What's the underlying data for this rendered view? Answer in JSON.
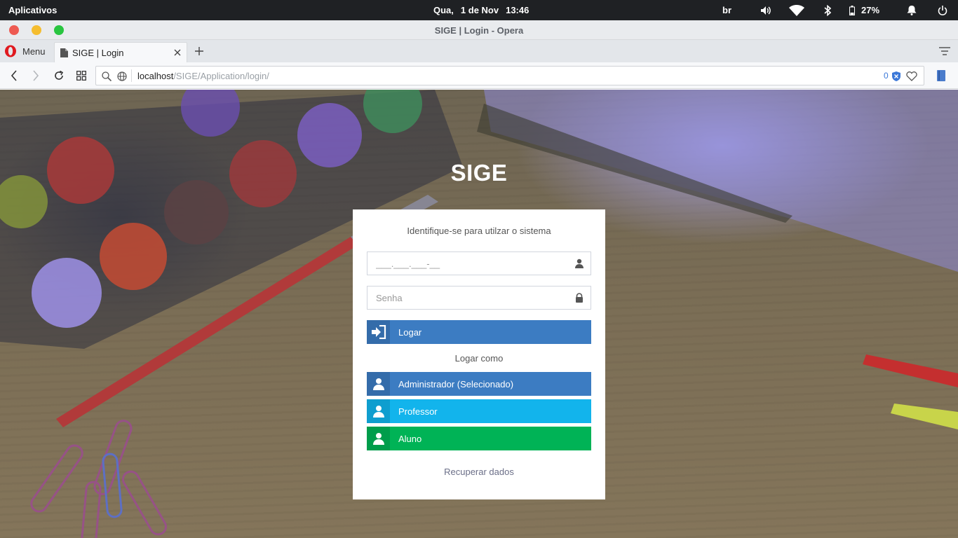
{
  "os": {
    "apps_label": "Aplicativos",
    "day": "Qua,",
    "date": "1 de Nov",
    "time": "13:46",
    "keyboard": "br",
    "battery": "27%"
  },
  "window": {
    "title": "SIGE | Login - Opera"
  },
  "browser": {
    "menu_label": "Menu",
    "tab_title": "SIGE | Login",
    "url_host": "localhost",
    "url_path": "/SIGE/Application/login/",
    "adblock_count": "0"
  },
  "page": {
    "brand": "SIGE",
    "subtitle": "Identifique-se para utilzar o sistema",
    "cpf_placeholder": "___.___.___-__",
    "password_placeholder": "Senha",
    "login_label": "Logar",
    "login_as_label": "Logar como",
    "roles": [
      {
        "label": "Administrador (Selecionado)",
        "color": "#3c7cc2"
      },
      {
        "label": "Professor",
        "color": "#12b4ec"
      },
      {
        "label": "Aluno",
        "color": "#00b356"
      }
    ],
    "recover_label": "Recuperar dados"
  },
  "colors": {
    "primary": "#3c7cc2",
    "light_blue": "#12b4ec",
    "green": "#00b356",
    "opera_red": "#e0191f"
  }
}
